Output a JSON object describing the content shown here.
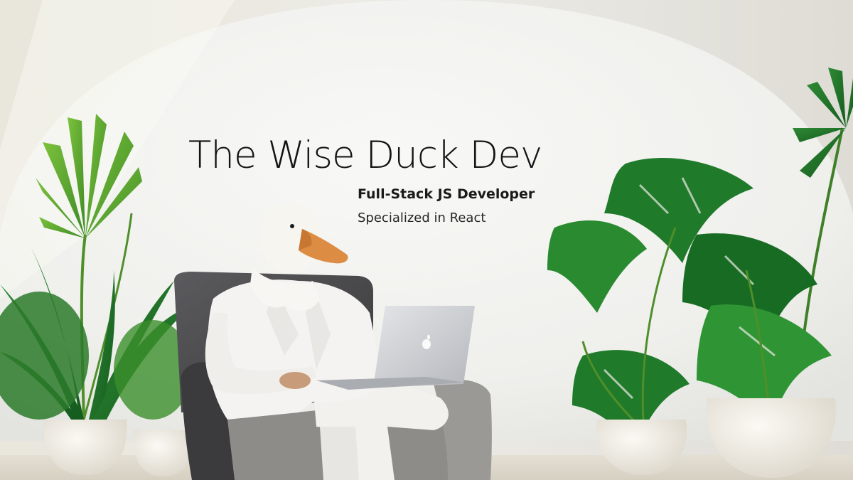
{
  "banner": {
    "title": "The Wise Duck Dev",
    "subtitle": "Full-Stack JS Developer",
    "tagline": "Specialized in React"
  },
  "colors": {
    "wall": "#eceae4",
    "arch": "#f3f3f1",
    "leaf_light": "#5fae2e",
    "leaf_dark": "#1f6b24",
    "pot": "#f1ede4",
    "chair": "#4a4a4c",
    "suit": "#f4f3f1",
    "beak": "#e0924a",
    "laptop": "#c9cbcf"
  },
  "icons": [
    "duck-figure",
    "laptop-icon",
    "apple-logo-icon",
    "armchair",
    "palm-plant",
    "monstera-plant",
    "planter-pot"
  ]
}
